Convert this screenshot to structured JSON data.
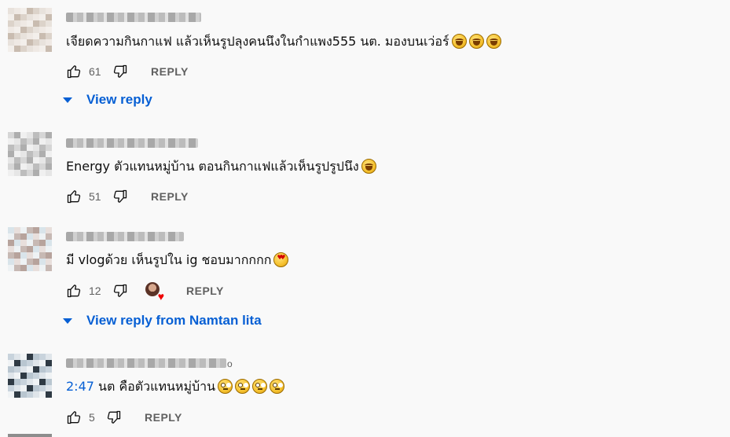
{
  "comments": [
    {
      "name_tail": "",
      "text": "เจียดความกินกาแฟ แล้วเห็นรูปลุงคนนึงในกำแพง555 นต. มองบนเว่อร์",
      "emojis": [
        "face-with-tears-of-joy",
        "face-with-tears-of-joy",
        "face-with-tears-of-joy"
      ],
      "likes": "61",
      "reply_label": "REPLY",
      "view_reply": "View reply"
    },
    {
      "name_tail": "",
      "text": "Energy ตัวแทนหมู่บ้าน ตอนกินกาแฟแล้วเห็นรูปรูปนึง",
      "emojis": [
        "face-with-tears-of-joy"
      ],
      "likes": "51",
      "reply_label": "REPLY"
    },
    {
      "name_tail": "",
      "text": "มี vlogด้วย เห็นรูปใน ig ชอบมากกกก",
      "emojis": [
        "heart-eyes-face"
      ],
      "likes": "12",
      "reply_label": "REPLY",
      "creator_heart": "creator-heart-icon",
      "view_reply": "View reply from Namtan lita"
    },
    {
      "name_tail": "o",
      "timestamp": "2:47",
      "text": " นต คือตัวแทนหมู่บ้าน",
      "emojis": [
        "face-with-rolling-eyes",
        "face-with-rolling-eyes",
        "face-with-rolling-eyes",
        "face-with-rolling-eyes"
      ],
      "likes": "5",
      "reply_label": "REPLY"
    }
  ],
  "colors": {
    "link": "#065fd4",
    "secondary_text": "#606060",
    "background": "#f9f9f9"
  }
}
